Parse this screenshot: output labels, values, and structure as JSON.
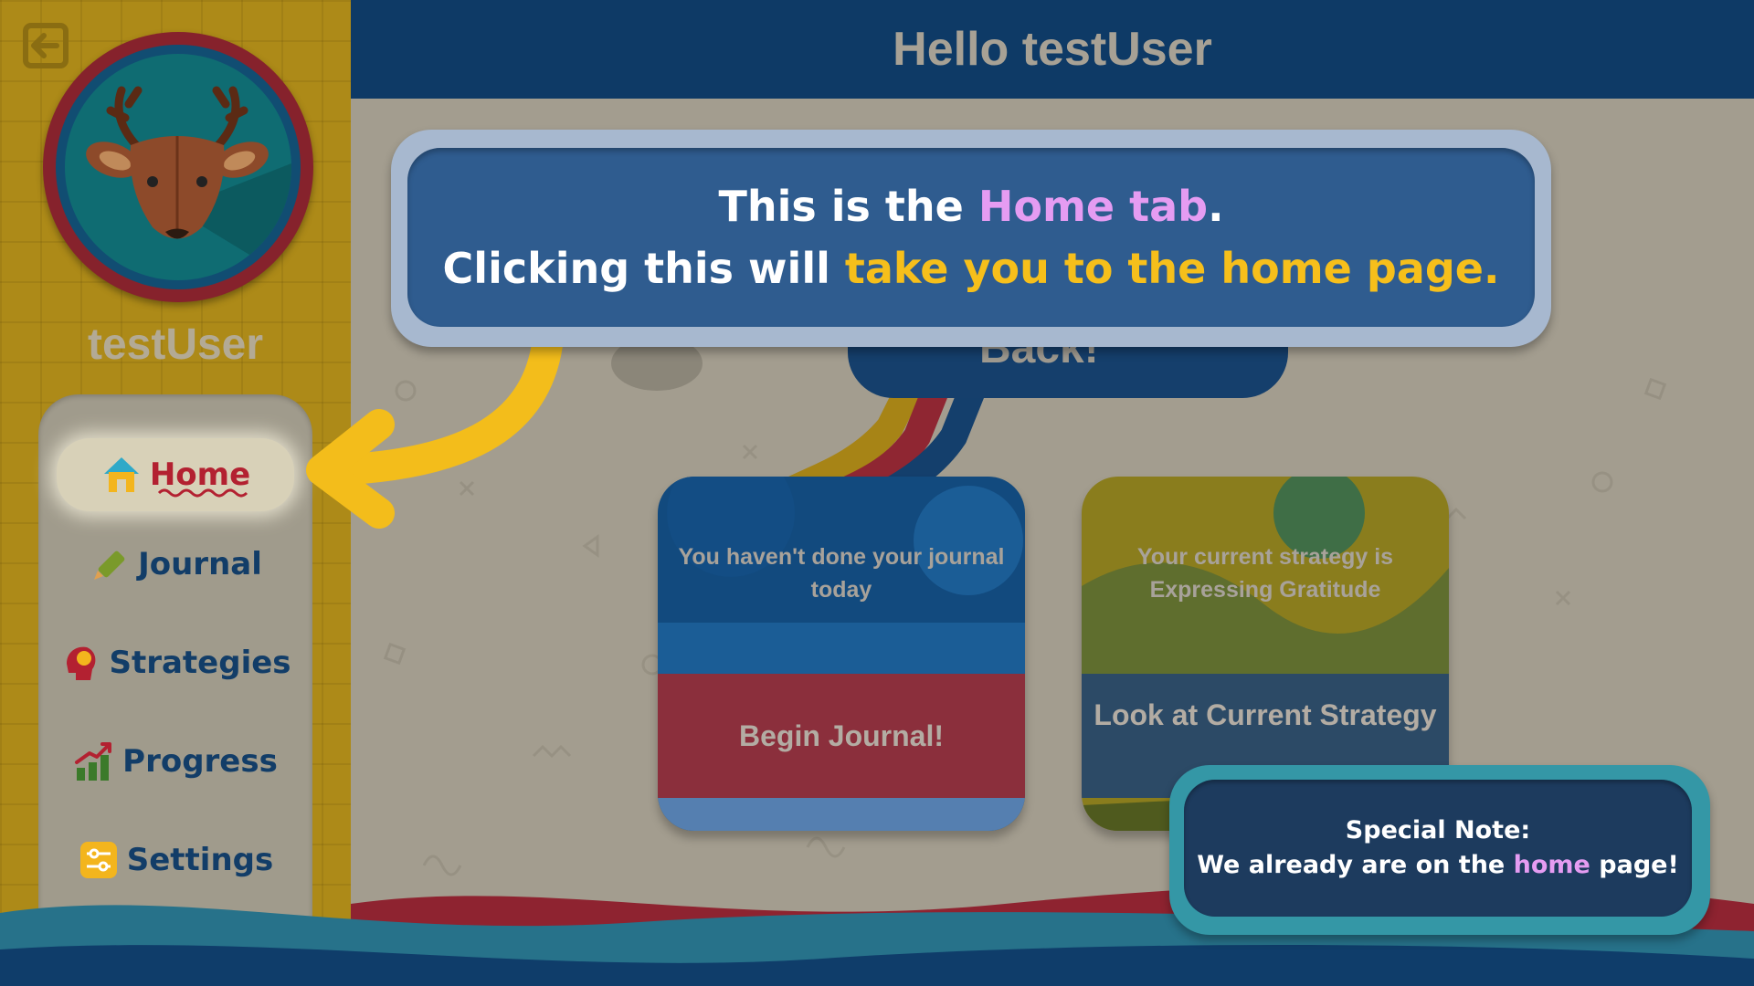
{
  "header": {
    "title": "Hello testUser"
  },
  "sidebar": {
    "username": "testUser",
    "items": [
      {
        "label": "Home",
        "active": true
      },
      {
        "label": "Journal"
      },
      {
        "label": "Strategies"
      },
      {
        "label": "Progress"
      },
      {
        "label": "Settings"
      }
    ]
  },
  "main": {
    "back_text": "Back!",
    "journal_card": {
      "status_text": "You haven't done your journal today",
      "button_label": "Begin Journal!"
    },
    "strategy_card": {
      "status_text": "Your current strategy is Expressing Gratitude",
      "button_label": "Look at Current Strategy"
    }
  },
  "tooltip": {
    "line1_a": "This is the ",
    "line1_b": "Home tab",
    "line1_c": ".",
    "line2_a": "Clicking this will ",
    "line2_b": "take you to the home page."
  },
  "note": {
    "title": "Special Note:",
    "text_a": "We already are on the ",
    "text_b": "home",
    "text_c": " page!"
  },
  "colors": {
    "header": "#0e3a66",
    "sidebar": "#ad8a18",
    "highlight_purple": "#e59cf2",
    "highlight_yellow": "#f6bf1b",
    "active_text": "#b32131"
  }
}
